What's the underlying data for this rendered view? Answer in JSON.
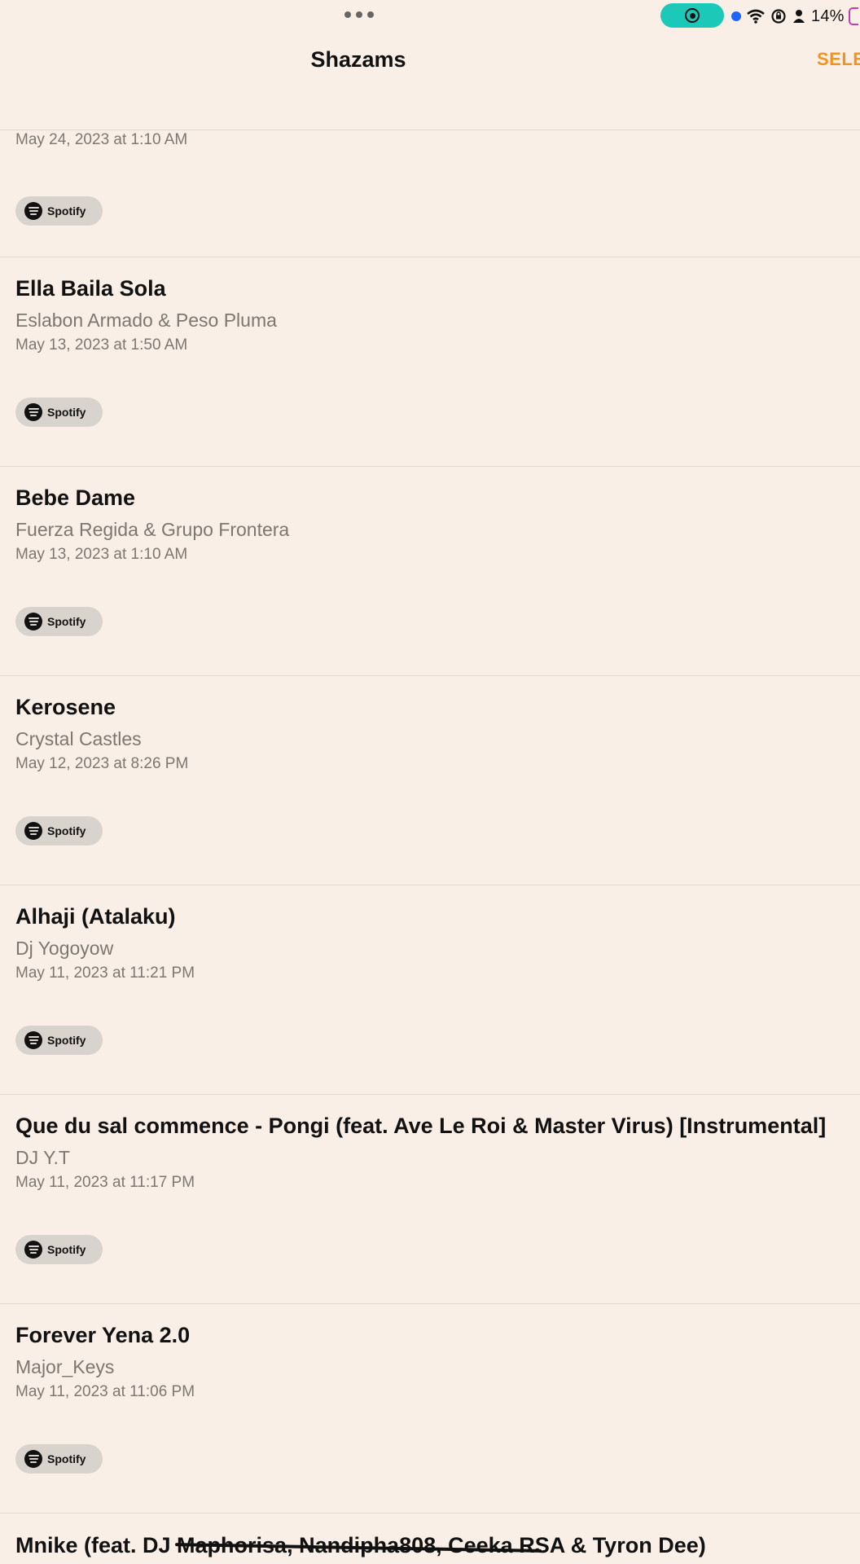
{
  "status_bar": {
    "battery_percent": "14%",
    "icons": [
      "more-dots-icon",
      "screen-record-icon",
      "location-dot-icon",
      "wifi-icon",
      "rotation-lock-icon",
      "person-icon",
      "battery-icon"
    ]
  },
  "nav": {
    "title": "Shazams",
    "select_label": "SELE"
  },
  "entries": [
    {
      "date": "May 24, 2023 at 1:10 AM",
      "service": "Spotify"
    },
    {
      "title": "Ella Baila Sola",
      "artist": "Eslabon Armado & Peso Pluma",
      "date": "May 13, 2023 at 1:50 AM",
      "service": "Spotify"
    },
    {
      "title": "Bebe Dame",
      "artist": "Fuerza Regida & Grupo Frontera",
      "date": "May 13, 2023 at 1:10 AM",
      "service": "Spotify"
    },
    {
      "title": "Kerosene",
      "artist": "Crystal Castles",
      "date": "May 12, 2023 at 8:26 PM",
      "service": "Spotify"
    },
    {
      "title": "Alhaji (Atalaku)",
      "artist": "Dj Yogoyow",
      "date": "May 11, 2023 at 11:21 PM",
      "service": "Spotify"
    },
    {
      "title": "Que du sal commence - Pongi (feat. Ave Le Roi & Master Virus) [Instrumental]",
      "artist": "DJ Y.T",
      "date": "May 11, 2023 at 11:17 PM",
      "service": "Spotify"
    },
    {
      "title": "Forever Yena 2.0",
      "artist": "Major_Keys",
      "date": "May 11, 2023 at 11:06 PM",
      "service": "Spotify"
    },
    {
      "title": "Mnike (feat. DJ Maphorisa, Nandipha808, Ceeka RSA & Tyron Dee)"
    }
  ],
  "colors": {
    "background": "#faefe6",
    "accent": "#f0941f",
    "record_pill": "#1cc9b8"
  }
}
